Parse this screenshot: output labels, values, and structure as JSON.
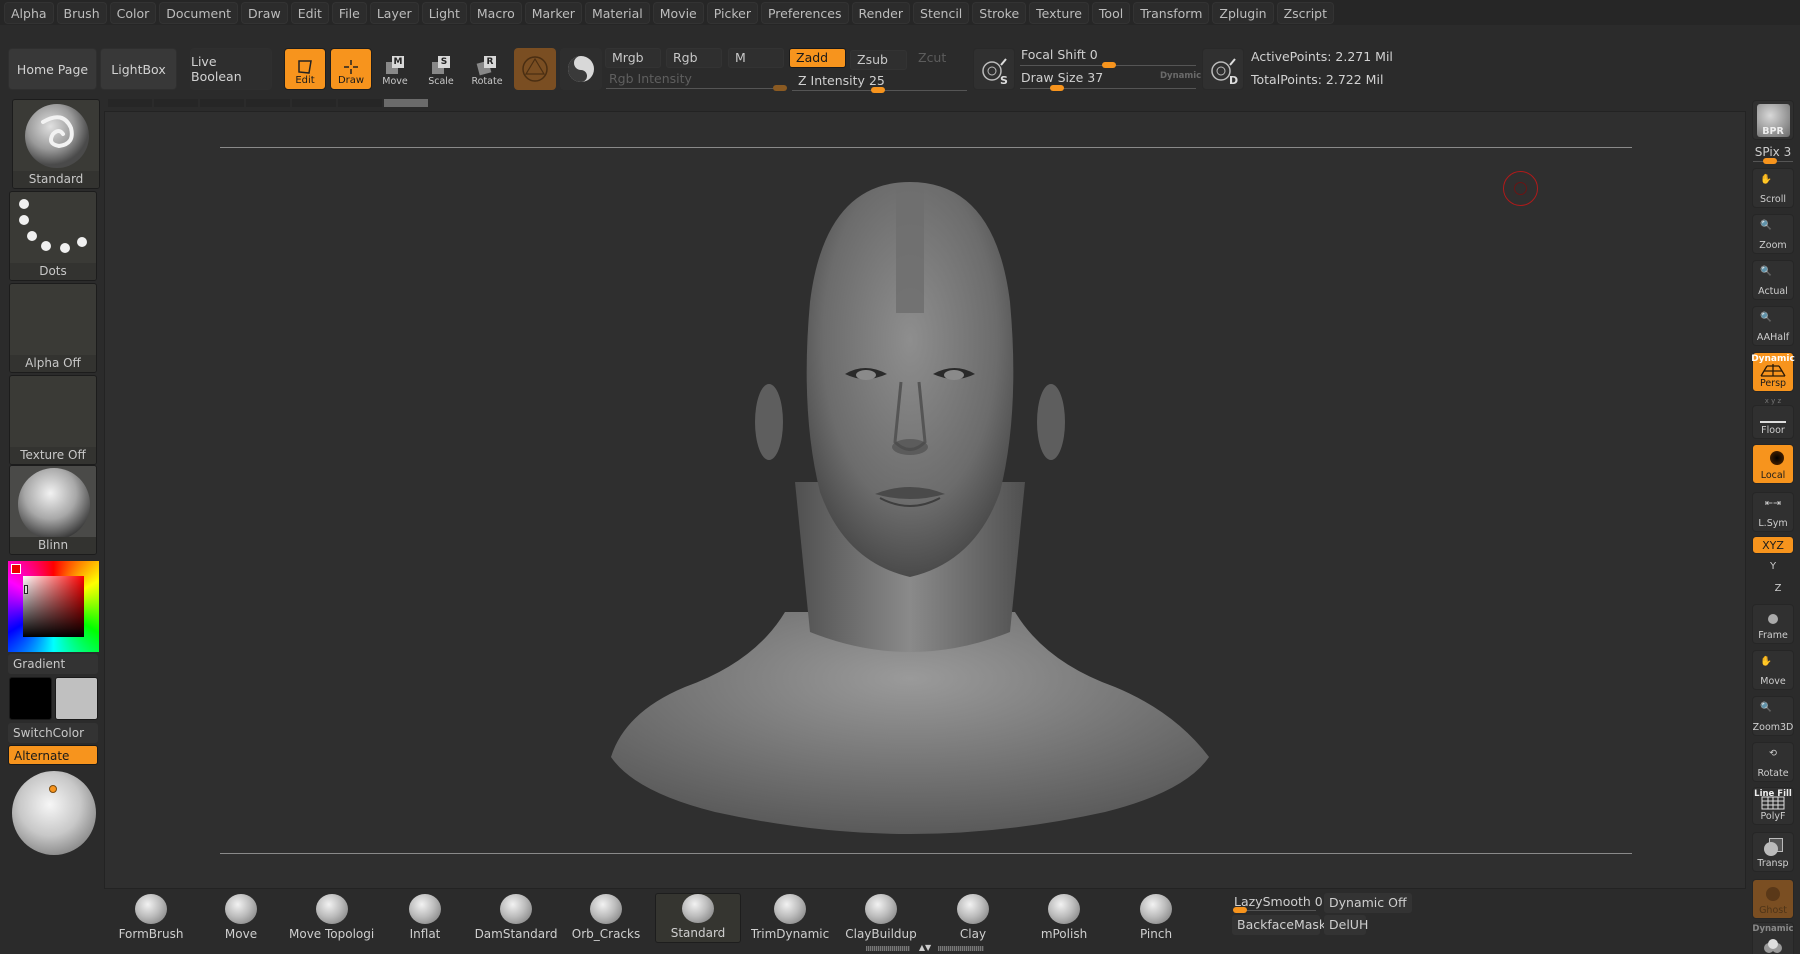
{
  "menu": [
    "Alpha",
    "Brush",
    "Color",
    "Document",
    "Draw",
    "Edit",
    "File",
    "Layer",
    "Light",
    "Macro",
    "Marker",
    "Material",
    "Movie",
    "Picker",
    "Preferences",
    "Render",
    "Stencil",
    "Stroke",
    "Texture",
    "Tool",
    "Transform",
    "Zplugin",
    "Zscript"
  ],
  "shelf": {
    "home_page": "Home Page",
    "lightbox": "LightBox",
    "live_boolean": "Live Boolean",
    "edit": "Edit",
    "draw": "Draw",
    "move": "Move",
    "move_key": "M",
    "scale": "Scale",
    "scale_key": "S",
    "rotate": "Rotate",
    "rotate_key": "R",
    "mrgb": "Mrgb",
    "rgb": "Rgb",
    "m": "M",
    "zadd": "Zadd",
    "zsub": "Zsub",
    "zcut": "Zcut",
    "rgb_intensity_label": "Rgb Intensity",
    "z_intensity_label": "Z Intensity",
    "z_intensity_value": "25",
    "focal_shift_label": "Focal Shift",
    "focal_shift_value": "0",
    "draw_size_label": "Draw Size",
    "draw_size_value": "37",
    "dynamic_label": "Dynamic",
    "s_key": "S",
    "d_key": "D",
    "active_points": "ActivePoints: 2.271 Mil",
    "total_points": "TotalPoints: 2.722 Mil"
  },
  "left_tray": {
    "brush": "Standard",
    "stroke": "Dots",
    "alpha": "Alpha Off",
    "texture": "Texture Off",
    "material": "Blinn",
    "gradient": "Gradient",
    "switch_color": "SwitchColor",
    "alternate": "Alternate",
    "main_color": "#000000",
    "secondary_color": "#c0c0c0"
  },
  "right_tray": {
    "bpr": "BPR",
    "spix": "SPix 3",
    "scroll": "Scroll",
    "zoom": "Zoom",
    "actual": "Actual",
    "aahalf": "AAHalf",
    "persp_dynamic": "Dynamic",
    "persp": "Persp",
    "xyz_axes": "x y z",
    "floor": "Floor",
    "local": "Local",
    "lsym": "L.Sym",
    "rot_xyz": "XYZ",
    "rot_y": "Y",
    "rot_z": "Z",
    "frame": "Frame",
    "move": "Move",
    "zoom3d": "Zoom3D",
    "rotate": "Rotate",
    "line_fill": "Line Fill",
    "polyf": "PolyF",
    "transp": "Transp",
    "ghost": "Ghost",
    "solo_dynamic": "Dynamic"
  },
  "brushes": [
    "FormBrush",
    "Move",
    "Move Topologica",
    "Inflat",
    "DamStandard",
    "Orb_Cracks",
    "Standard",
    "TrimDynamic",
    "ClayBuildup",
    "Clay",
    "mPolish",
    "Pinch"
  ],
  "selected_brush": "Standard",
  "bottom": {
    "lazysmooth": "LazySmooth 0",
    "dynamic_off": "Dynamic Off",
    "backface_mask": "BackfaceMask",
    "deluh": "DelUH"
  },
  "colors": {
    "accent": "#f7941d",
    "cursor": "#b01a1a"
  }
}
